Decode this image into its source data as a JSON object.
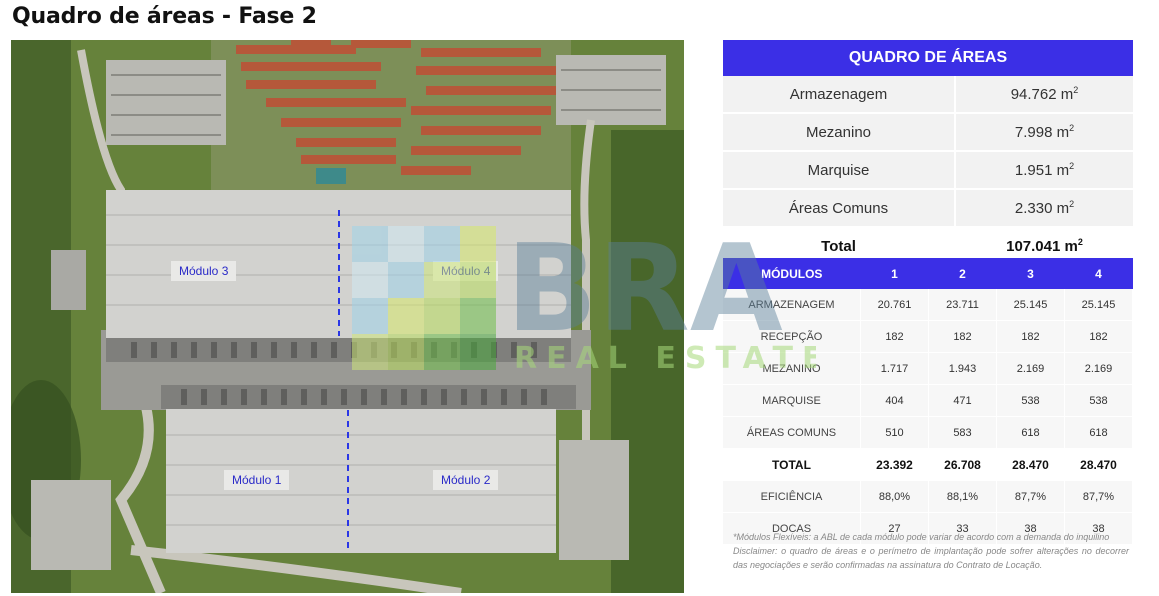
{
  "page": {
    "title": "Quadro de áreas - Fase 2"
  },
  "site_plan": {
    "modules": [
      {
        "label": "Módulo 3"
      },
      {
        "label": "Módulo 4"
      },
      {
        "label": "Módulo 1"
      },
      {
        "label": "Módulo 2"
      }
    ]
  },
  "areas": {
    "header": "QUADRO DE ÁREAS",
    "unit": "m",
    "unit_exp": "2",
    "rows": [
      {
        "label": "Armazenagem",
        "value": "94.762"
      },
      {
        "label": "Mezanino",
        "value": "7.998"
      },
      {
        "label": "Marquise",
        "value": "1.951"
      },
      {
        "label": "Áreas Comuns",
        "value": "2.330"
      }
    ],
    "total": {
      "label": "Total",
      "value": "107.041"
    }
  },
  "modules_table": {
    "headers": [
      "MÓDULOS",
      "1",
      "2",
      "3",
      "4"
    ],
    "rows": [
      {
        "label": "ARMAZENAGEM",
        "values": [
          "20.761",
          "23.711",
          "25.145",
          "25.145"
        ]
      },
      {
        "label": "RECEPÇÃO",
        "values": [
          "182",
          "182",
          "182",
          "182"
        ]
      },
      {
        "label": "MEZANINO",
        "values": [
          "1.717",
          "1.943",
          "2.169",
          "2.169"
        ]
      },
      {
        "label": "MARQUISE",
        "values": [
          "404",
          "471",
          "538",
          "538"
        ]
      },
      {
        "label": "ÁREAS COMUNS",
        "values": [
          "510",
          "583",
          "618",
          "618"
        ]
      },
      {
        "label": "TOTAL",
        "values": [
          "23.392",
          "26.708",
          "28.470",
          "28.470"
        ]
      },
      {
        "label": "EFICIÊNCIA",
        "values": [
          "88,0%",
          "88,1%",
          "87,7%",
          "87,7%"
        ]
      },
      {
        "label": "DOCAS",
        "values": [
          "27",
          "33",
          "38",
          "38"
        ]
      }
    ]
  },
  "notes": {
    "flex": "*Módulos Flexíveis: a ABL de cada módulo pode variar de acordo com a demanda do inquilino",
    "disclaimer": "Disclaimer: o quadro de áreas e o perímetro de implantação pode sofrer alterações no decorrer das negociações e serão confirmadas na assinatura do Contrato de Locação."
  },
  "watermark": {
    "brand": "BRA",
    "sub": "REAL ESTATE"
  },
  "colors": {
    "accent": "#3b2fe6",
    "grass": "#6f8a3c",
    "roof": "#c9c9c9",
    "housing_roof": "#b5583a"
  }
}
